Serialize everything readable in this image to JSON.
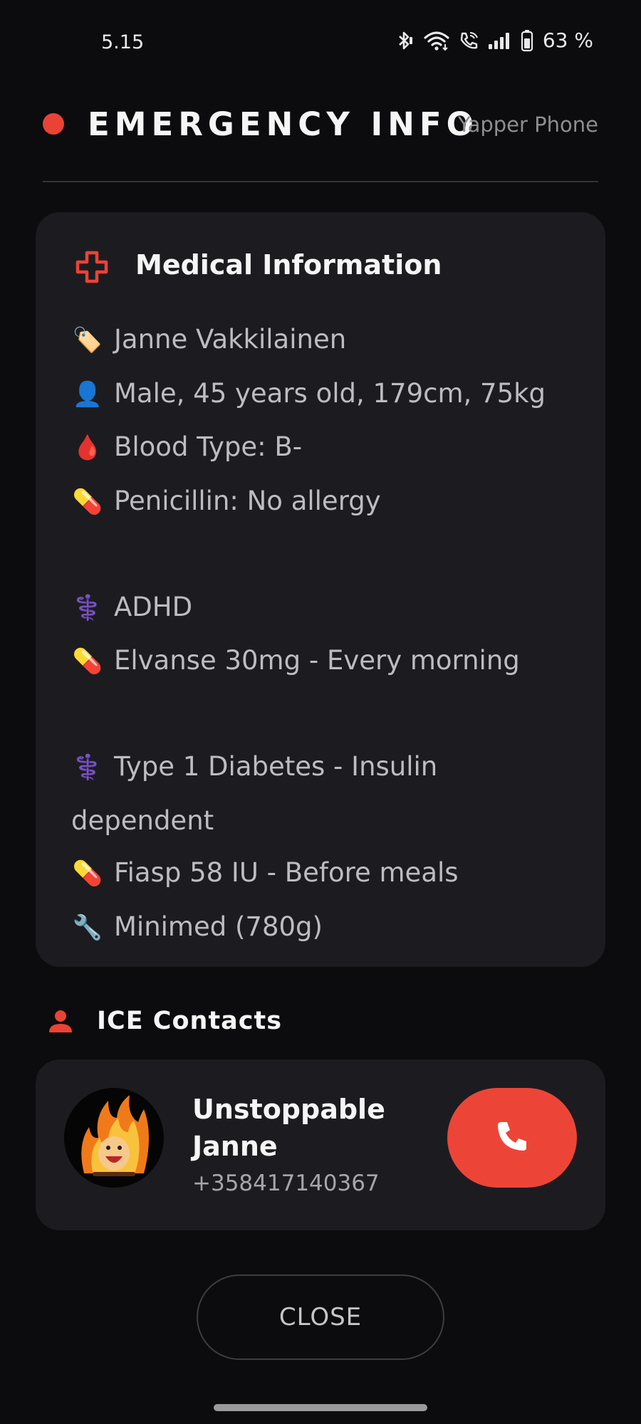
{
  "status_bar": {
    "time": "5.15",
    "battery": "63 %",
    "icons": [
      "bluetooth-icon",
      "wifi-icon",
      "wifi-calling-icon",
      "signal-icon",
      "battery-icon"
    ]
  },
  "header": {
    "title": "EMERGENCY INFO",
    "subtitle": "Yapper Phone",
    "dot_color": "#ea4335"
  },
  "medical": {
    "title": "Medical Information",
    "icon": "medical-cross-icon",
    "lines": [
      {
        "icon": "🏷️",
        "text": "Janne Vakkilainen"
      },
      {
        "icon": "👤",
        "text": "Male, 45 years old, 179cm, 75kg"
      },
      {
        "icon": "🩸",
        "text": "Blood Type: B-"
      },
      {
        "icon": "💊",
        "text": "Penicillin: No allergy"
      },
      {
        "icon": "",
        "text": ""
      },
      {
        "icon": "⚕️",
        "text": "ADHD"
      },
      {
        "icon": "💊",
        "text": "Elvanse 30mg - Every morning"
      },
      {
        "icon": "",
        "text": ""
      },
      {
        "icon": "⚕️",
        "text": "Type 1 Diabetes - Insulin"
      },
      {
        "icon": "",
        "text": "dependent"
      },
      {
        "icon": "💊",
        "text": "Fiasp 58 IU - Before meals"
      },
      {
        "icon": "🔧",
        "text": "Minimed (780g)"
      }
    ]
  },
  "ice": {
    "title": "ICE Contacts",
    "icon": "person-icon",
    "contact": {
      "name": "Unstoppable Janne",
      "phone": "+358417140367",
      "avatar": "flaming-face-avatar"
    },
    "call_icon": "phone-icon"
  },
  "close_label": "CLOSE",
  "colors": {
    "accent": "#ea4335",
    "background": "#0c0c0e",
    "card": "#1c1c20"
  }
}
